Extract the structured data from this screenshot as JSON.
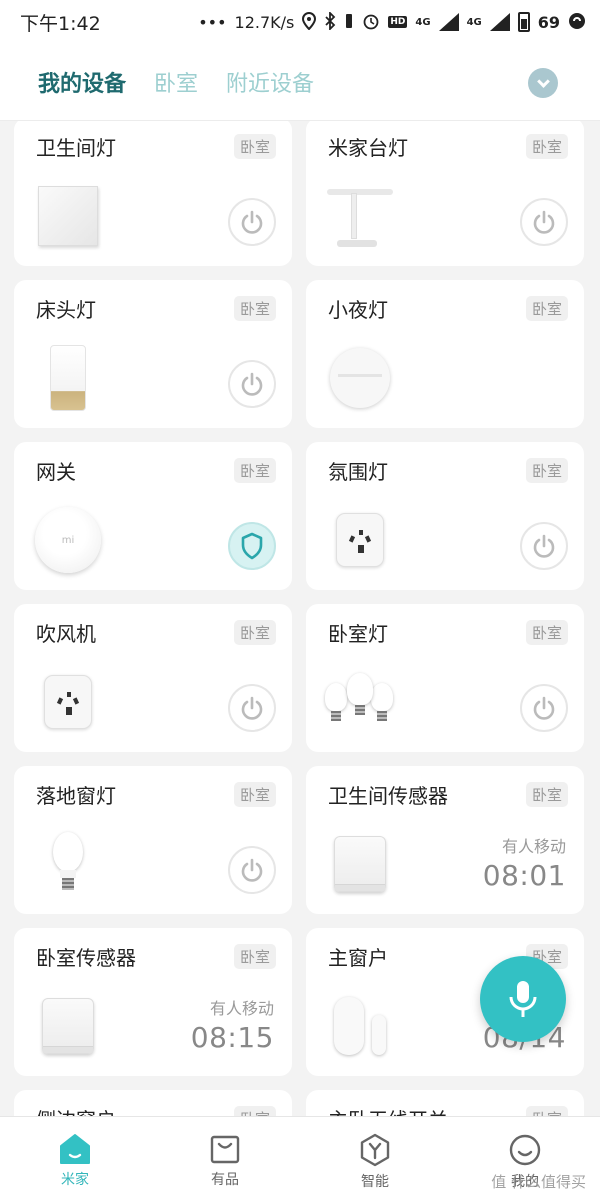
{
  "status_bar": {
    "time": "下午1:42",
    "dots": "•••",
    "speed": "12.7K/s",
    "hd": "HD",
    "net1": "4G",
    "net2": "4G",
    "battery": "69"
  },
  "top_tabs": [
    {
      "label": "我的设备",
      "active": true
    },
    {
      "label": "卧室",
      "active": false
    },
    {
      "label": "附近设备",
      "active": false
    }
  ],
  "devices": [
    {
      "name": "卫生间灯",
      "room": "卧室",
      "image": "wall-switch",
      "control": "power"
    },
    {
      "name": "米家台灯",
      "room": "卧室",
      "image": "desk-lamp",
      "control": "power"
    },
    {
      "name": "床头灯",
      "room": "卧室",
      "image": "bedside-lamp",
      "control": "power"
    },
    {
      "name": "小夜灯",
      "room": "卧室",
      "image": "night-light",
      "control": "none"
    },
    {
      "name": "网关",
      "room": "卧室",
      "image": "gateway",
      "control": "shield"
    },
    {
      "name": "氛围灯",
      "room": "卧室",
      "image": "smart-plug",
      "control": "power"
    },
    {
      "name": "吹风机",
      "room": "卧室",
      "image": "smart-plug",
      "control": "power"
    },
    {
      "name": "卧室灯",
      "room": "卧室",
      "image": "bulbs",
      "control": "power"
    },
    {
      "name": "落地窗灯",
      "room": "卧室",
      "image": "bulb",
      "control": "power"
    },
    {
      "name": "卫生间传感器",
      "room": "卧室",
      "image": "motion-sensor",
      "control": "sensor",
      "status": "有人移动",
      "time": "08:01"
    },
    {
      "name": "卧室传感器",
      "room": "卧室",
      "image": "motion-sensor",
      "control": "sensor",
      "status": "有人移动",
      "time": "08:15"
    },
    {
      "name": "主窗户",
      "room": "卧室",
      "image": "window-sensor",
      "control": "sensor",
      "status": "",
      "time": "08/14"
    },
    {
      "name": "侧边窗户",
      "room": "卧室",
      "image": "none",
      "control": "none"
    },
    {
      "name": "主卧无线开关",
      "room": "卧室",
      "image": "none",
      "control": "none"
    }
  ],
  "bottom_nav": [
    {
      "label": "米家",
      "icon": "home-icon",
      "active": true
    },
    {
      "label": "有品",
      "icon": "shopping-bag-icon",
      "active": false
    },
    {
      "label": "智能",
      "icon": "hexagon-y-icon",
      "active": false
    },
    {
      "label": "我的",
      "icon": "smile-icon",
      "active": false
    }
  ],
  "watermark": "值 什么值得买",
  "colors": {
    "accent": "#33c1c4",
    "active_tab": "#1f6a6f",
    "inactive_tab": "#9dcfd0"
  }
}
